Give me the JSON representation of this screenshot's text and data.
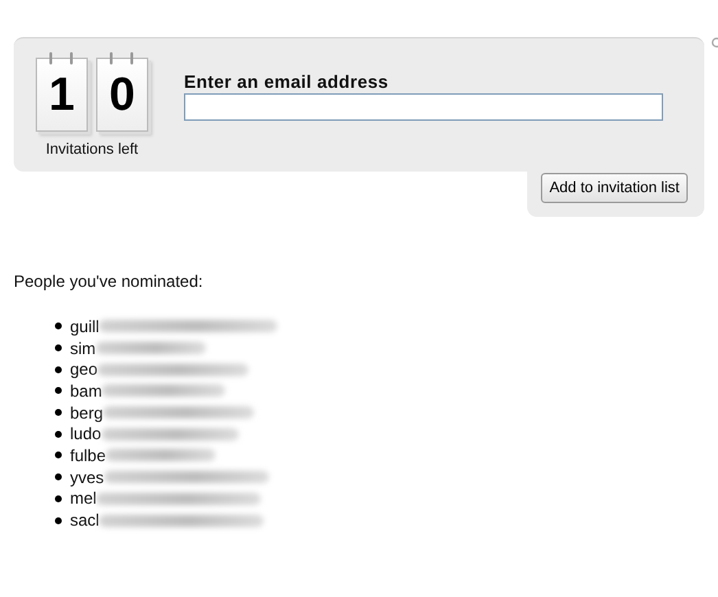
{
  "invite_panel": {
    "digits": [
      "1",
      "0"
    ],
    "counter_label": "Invitations left",
    "email_label": "Enter an email address",
    "add_button": "Add to invitation list"
  },
  "nominated": {
    "heading": "People you've nominated:",
    "people": [
      {
        "name": "guill"
      },
      {
        "name": "sim"
      },
      {
        "name": "geo"
      },
      {
        "name": "bam"
      },
      {
        "name": "berg"
      },
      {
        "name": "ludo"
      },
      {
        "name": "fulbe"
      },
      {
        "name": "yves"
      },
      {
        "name": "mel"
      },
      {
        "name": "sacl"
      }
    ]
  }
}
